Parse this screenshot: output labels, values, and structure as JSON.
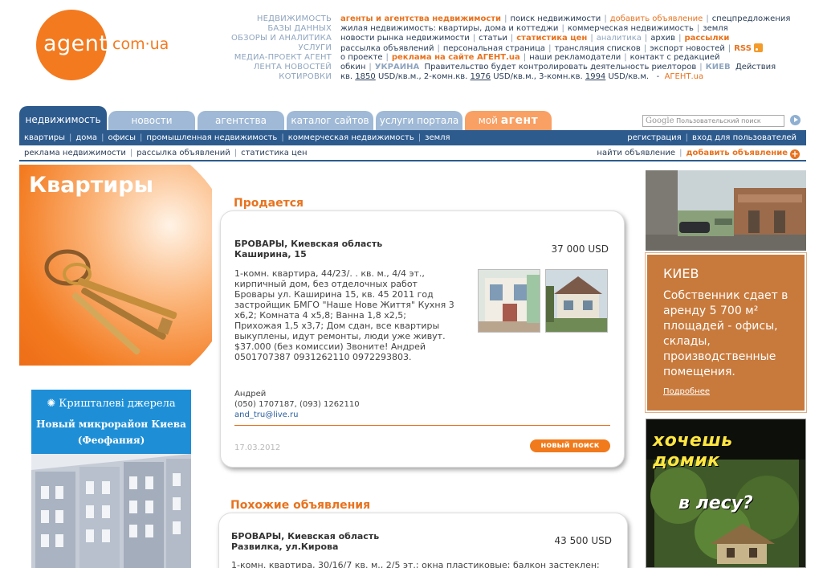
{
  "logo": {
    "agent": "agent",
    "domain": "com·ua"
  },
  "top_nav": [
    {
      "label": "НЕДВИЖИМОСТЬ",
      "items": [
        {
          "text": "агенты и агентства недвижимости",
          "style": "o"
        },
        {
          "text": "поиск недвижимости"
        },
        {
          "text": "добавить объявление",
          "style": "orange-plain"
        },
        {
          "text": "спецпредложения"
        }
      ]
    },
    {
      "label": "БАЗЫ ДАННЫХ",
      "items": [
        {
          "text": "жилая недвижимость: квартиры, дома и коттеджи"
        },
        {
          "text": "коммерческая недвижимость"
        },
        {
          "text": "земля"
        }
      ]
    },
    {
      "label": "ОБЗОРЫ И АНАЛИТИКА",
      "items": [
        {
          "text": "новости рынка недвижимости"
        },
        {
          "text": "статьи"
        },
        {
          "text": "статистика цен",
          "style": "o"
        },
        {
          "text": "аналитика",
          "style": "gray"
        },
        {
          "text": "архив"
        },
        {
          "text": "рассылки",
          "style": "o"
        }
      ]
    },
    {
      "label": "УСЛУГИ",
      "items": [
        {
          "text": "рассылка объявлений"
        },
        {
          "text": "персональная страница"
        },
        {
          "text": "трансляция списков"
        },
        {
          "text": "экспорт новостей"
        },
        {
          "text": "RSS",
          "style": "rss"
        }
      ]
    },
    {
      "label": "МЕДИА-ПРОЕКТ АГЕНТ",
      "items": [
        {
          "text": "о проекте"
        },
        {
          "text": "реклама на сайте АГЕНТ.ua",
          "style": "o"
        },
        {
          "text": "наши рекламодатели"
        },
        {
          "text": "контакт с редакцией"
        }
      ]
    }
  ],
  "news_ticker": {
    "label": "ЛЕНТА НОВОСТЕЙ",
    "left": "обкин",
    "region": "УКРАИНА",
    "text": "Правительство будет контролировать деятельность риелторов",
    "region2": "КИЕВ",
    "text2": "Действия"
  },
  "quotes": {
    "label": "КОТИРОВКИ",
    "prefix": "кв.",
    "v1": "1850",
    "u1": "USD/кв.м., 2-комн.кв.",
    "v2": "1976",
    "u2": "USD/кв.м., 3-комн.кв.",
    "v3": "1994",
    "u3": "USD/кв.м.",
    "source": "АГЕНТ.ua"
  },
  "tabs": [
    {
      "label": "недвижимость",
      "active": true
    },
    {
      "label": "новости"
    },
    {
      "label": "агентства"
    },
    {
      "label": "каталог сайтов"
    },
    {
      "label": "услуги портала"
    },
    {
      "label_pre": "мой",
      "label_bold": "агент"
    }
  ],
  "search": {
    "google": "Google",
    "placeholder": "Пользовательский поиск"
  },
  "subnav": {
    "items": [
      "квартиры",
      "дома",
      "офисы",
      "промышленная недвижимость",
      "коммерческая недвижимость",
      "земля"
    ],
    "right": [
      "регистрация",
      "вход для пользователей"
    ]
  },
  "subnav2": {
    "items": [
      "реклама недвижимости",
      "рассылка объявлений",
      "статистика цен"
    ],
    "find": "найти объявление",
    "add": "добавить объявление"
  },
  "hero": {
    "title": "Квартиры"
  },
  "ad_left": {
    "brand": "Кришталеві джерела",
    "line1": "Новый микрорайон Киева",
    "line2": "(Феофания)"
  },
  "listing": {
    "section": "Продается",
    "city": "БРОВАРЫ, Киевская область",
    "street": "Каширина, 15",
    "price": "37 000 USD",
    "description": [
      "1-комн. квартира, 44/23/. . кв. м., 4/4 эт.,",
      "кирпичный дом, без отделочных работ",
      "Бровары ул. Каширина 15, кв. 45 2011 год",
      "застройщик БМГО \"Наше Нове Життя\" Кухня 3",
      "х6,2; Комната 4 х5,8; Ванна 1,8 х2,5;",
      "Прихожая 1,5 х3,7; Дом сдан, все квартиры",
      "выкуплены, идут ремонты, люди уже живут.",
      "$37.000 (без комиссии) Звоните! Андрей",
      "0501707387 0931262110 0972293803."
    ],
    "contact_name": "Андрей",
    "contact_phone": "(050) 1707187, (093) 1262110",
    "contact_email": "and_tru@live.ru",
    "date": "17.03.2012",
    "button": "новый поиск"
  },
  "similar": {
    "section": "Похожие объявления",
    "city": "БРОВАРЫ, Киевская область",
    "street": "Развилка, ул.Кирова",
    "price": "43 500 USD",
    "description": "1-комн. квартира, 30/16/7 кв. м., 2/5 эт.; окна пластиковые; балкон застеклен;"
  },
  "kiev_box": {
    "title": "КИЕВ",
    "text": "Собственник сдает в аренду 5 700 м² площадей - офисы, склады, производственные помещения.",
    "more": "Подробнее"
  },
  "right_banner": {
    "line1": "хочешь домик",
    "line2": "в лесу?"
  }
}
